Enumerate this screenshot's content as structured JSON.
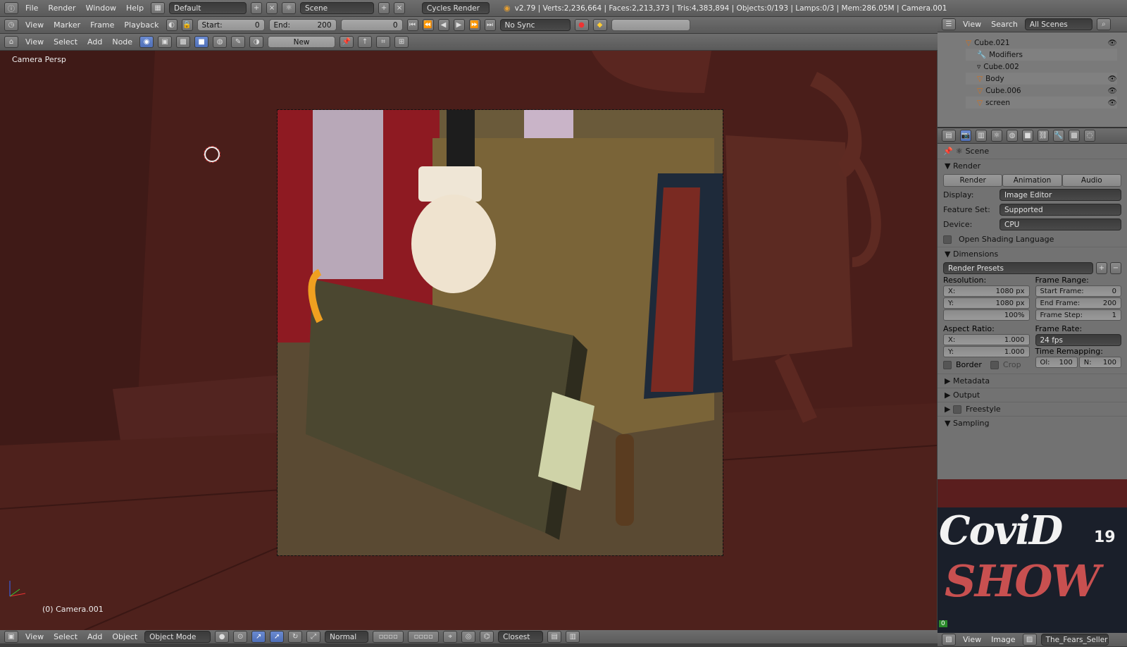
{
  "topbar": {
    "menus": [
      "File",
      "Render",
      "Window",
      "Help"
    ],
    "layout": "Default",
    "scene": "Scene",
    "engine": "Cycles Render",
    "stats": "v2.79 | Verts:2,236,664 | Faces:2,213,373 | Tris:4,383,894 | Objects:0/193 | Lamps:0/3 | Mem:286.05M | Camera.001"
  },
  "timeline": {
    "menus": [
      "View",
      "Marker",
      "Frame",
      "Playback"
    ],
    "start_label": "Start:",
    "start": "0",
    "end_label": "End:",
    "end": "200",
    "current": "0",
    "sync": "No Sync"
  },
  "node_header": {
    "menus": [
      "View",
      "Select",
      "Add",
      "Node"
    ],
    "new_label": "New"
  },
  "viewport": {
    "label": "Camera Persp",
    "object_label": "(0) Camera.001"
  },
  "view3d_header": {
    "menus": [
      "View",
      "Select",
      "Add",
      "Object"
    ],
    "mode": "Object Mode",
    "orientation": "Normal",
    "snap": "Closest"
  },
  "outliner": {
    "menus": [
      "View",
      "Search"
    ],
    "filter": "All Scenes",
    "rows": [
      "Cube.021",
      "Modifiers",
      "Cube.002",
      "Body",
      "Cube.006",
      "screen"
    ]
  },
  "props": {
    "context": "Scene",
    "render_section": "Render",
    "render_buttons": [
      "Render",
      "Animation",
      "Audio"
    ],
    "display_label": "Display:",
    "display_value": "Image Editor",
    "feature_label": "Feature Set:",
    "feature_value": "Supported",
    "device_label": "Device:",
    "device_value": "CPU",
    "osl_label": "Open Shading Language",
    "dimensions_section": "Dimensions",
    "presets": "Render Presets",
    "resolution_label": "Resolution:",
    "res_x_label": "X:",
    "res_x": "1080 px",
    "res_y_label": "Y:",
    "res_y": "1080 px",
    "res_pct": "100%",
    "frame_range_label": "Frame Range:",
    "start_frame_label": "Start Frame:",
    "start_frame": "0",
    "end_frame_label": "End Frame:",
    "end_frame": "200",
    "frame_step_label": "Frame Step:",
    "frame_step": "1",
    "aspect_label": "Aspect Ratio:",
    "asp_x_label": "X:",
    "asp_x": "1.000",
    "asp_y_label": "Y:",
    "asp_y": "1.000",
    "frame_rate_label": "Frame Rate:",
    "frame_rate": "24 fps",
    "time_remap_label": "Time Remapping:",
    "old_label": "Ol:",
    "old": "100",
    "new_label": "N:",
    "new": "100",
    "border_label": "Border",
    "crop_label": "Crop",
    "sections": [
      "Metadata",
      "Output",
      "Freestyle",
      "Sampling"
    ]
  },
  "imageview": {
    "line1": "CoviD",
    "num": "19",
    "line2": "SHOW",
    "frame_badge": "0",
    "menus": [
      "View",
      "Image"
    ],
    "image_name": "The_Fears_Seller_C..."
  }
}
